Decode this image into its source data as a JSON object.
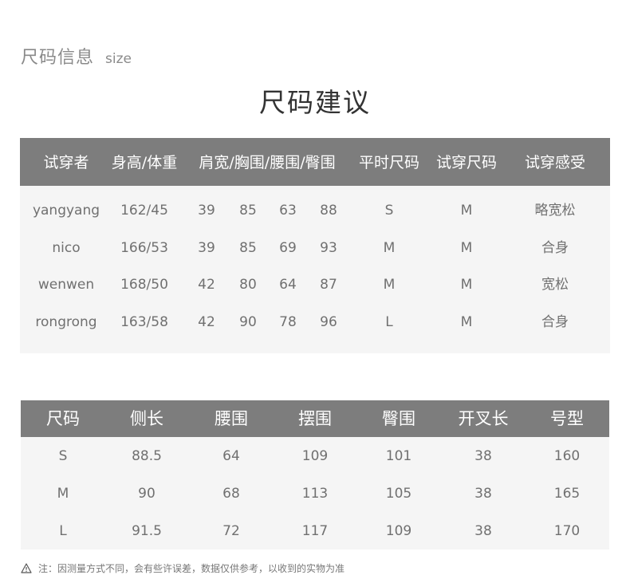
{
  "header": {
    "cn": "尺码信息",
    "en": "size"
  },
  "title": "尺码建议",
  "tryon_table": {
    "headers": [
      "试穿者",
      "身高/体重",
      "肩宽/胸围/腰围/臀围",
      "平时尺码",
      "试穿尺码",
      "试穿感受"
    ],
    "rows": [
      [
        "yangyang",
        "162/45",
        "39",
        "85",
        "63",
        "88",
        "S",
        "M",
        "略宽松"
      ],
      [
        "nico",
        "166/53",
        "39",
        "85",
        "69",
        "93",
        "M",
        "M",
        "合身"
      ],
      [
        "wenwen",
        "168/50",
        "42",
        "80",
        "64",
        "87",
        "M",
        "M",
        "宽松"
      ],
      [
        "rongrong",
        "163/58",
        "42",
        "90",
        "78",
        "96",
        "L",
        "M",
        "合身"
      ]
    ]
  },
  "size_table": {
    "headers": [
      "尺码",
      "侧长",
      "腰围",
      "摆围",
      "臀围",
      "开叉长",
      "号型"
    ],
    "rows": [
      [
        "S",
        "88.5",
        "64",
        "109",
        "101",
        "38",
        "160"
      ],
      [
        "M",
        "90",
        "68",
        "113",
        "105",
        "38",
        "165"
      ],
      [
        "L",
        "91.5",
        "72",
        "117",
        "109",
        "38",
        "170"
      ]
    ]
  },
  "note": "注：因测量方式不同，会有些许误差，数据仅供参考，以收到的实物为准",
  "icons": {
    "note_icon": "warning-icon"
  },
  "colors": {
    "header_bg": "#7d7d7d",
    "table_bg": "#f5f5f5",
    "title": "#333333"
  }
}
